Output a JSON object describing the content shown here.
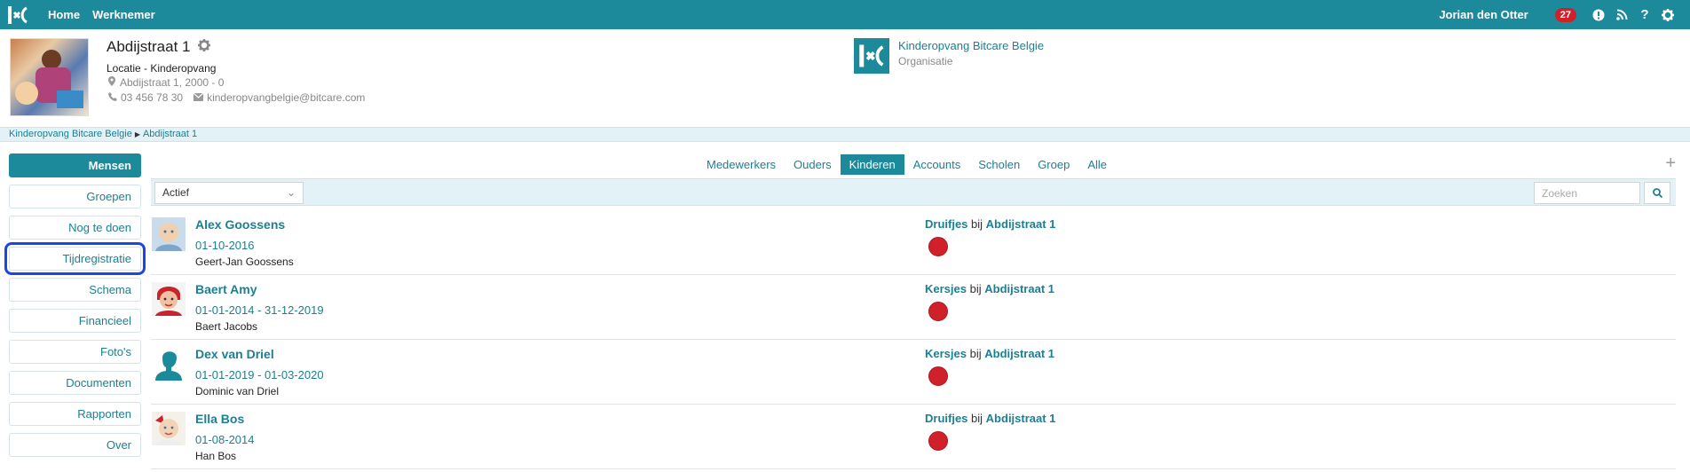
{
  "topbar": {
    "nav": [
      "Home",
      "Werknemer"
    ],
    "user": "Jorian den Otter",
    "notification_count": "27",
    "icons": [
      "info-icon",
      "rss-icon",
      "help-icon",
      "gear-icon"
    ]
  },
  "location": {
    "title": "Abdijstraat 1",
    "type": "Locatie - Kinderopvang",
    "address": "Abdijstraat 1, 2000 - 0",
    "phone": "03 456 78 30",
    "email": "kinderopvangbelgie@bitcare.com"
  },
  "organization": {
    "name": "Kinderopvang Bitcare Belgie",
    "subtitle": "Organisatie"
  },
  "breadcrumb": [
    "Kinderopvang Bitcare Belgie",
    "Abdijstraat 1"
  ],
  "sidebar": {
    "items": [
      {
        "label": "Mensen"
      },
      {
        "label": "Groepen"
      },
      {
        "label": "Nog te doen"
      },
      {
        "label": "Tijdregistratie"
      },
      {
        "label": "Schema"
      },
      {
        "label": "Financieel"
      },
      {
        "label": "Foto's"
      },
      {
        "label": "Documenten"
      },
      {
        "label": "Rapporten"
      },
      {
        "label": "Over"
      }
    ]
  },
  "tabs": [
    "Medewerkers",
    "Ouders",
    "Kinderen",
    "Accounts",
    "Scholen",
    "Groep",
    "Alle"
  ],
  "filter": {
    "status": "Actief",
    "search_placeholder": "Zoeken"
  },
  "children": [
    {
      "name": "Alex Goossens",
      "date": "01-10-2016",
      "parent": "Geert-Jan Goossens",
      "group": "Druifjes",
      "connector": "bij",
      "location": "Abdijstraat 1"
    },
    {
      "name": "Baert Amy",
      "date": "01-01-2014 - 31-12-2019",
      "parent": "Baert Jacobs",
      "group": "Kersjes",
      "connector": "bij",
      "location": "Abdijstraat 1"
    },
    {
      "name": "Dex van Driel",
      "date": "01-01-2019 - 01-03-2020",
      "parent": "Dominic van Driel",
      "group": "Kersjes",
      "connector": "bij",
      "location": "Abdijstraat 1"
    },
    {
      "name": "Ella Bos",
      "date": "01-08-2014",
      "parent": "Han Bos",
      "group": "Druifjes",
      "connector": "bij",
      "location": "Abdijstraat 1"
    }
  ],
  "colors": {
    "primary": "#1c8a9b",
    "status_red": "#d0202a",
    "focus_outline": "#1947e0"
  }
}
